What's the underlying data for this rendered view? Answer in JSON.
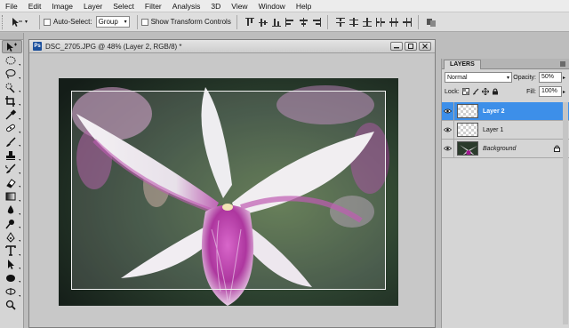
{
  "menu": [
    "File",
    "Edit",
    "Image",
    "Layer",
    "Select",
    "Filter",
    "Analysis",
    "3D",
    "View",
    "Window",
    "Help"
  ],
  "options": {
    "auto_select_label": "Auto-Select:",
    "auto_select_value": "Group",
    "show_transform_label": "Show Transform Controls"
  },
  "tools": [
    "move-tool",
    "marquee-tool",
    "lasso-tool",
    "quick-select-tool",
    "crop-tool",
    "eyedropper-tool",
    "healing-brush-tool",
    "brush-tool",
    "clone-stamp-tool",
    "history-brush-tool",
    "eraser-tool",
    "gradient-tool",
    "blur-tool",
    "dodge-tool",
    "pen-tool",
    "type-tool",
    "path-select-tool",
    "shape-tool",
    "hand-tool",
    "zoom-tool"
  ],
  "document": {
    "badge": "Ps",
    "title": "DSC_2705.JPG @ 48% (Layer 2, RGB/8) *"
  },
  "layers_panel": {
    "tab": "LAYERS",
    "blend_mode": "Normal",
    "opacity_label": "Opacity:",
    "opacity_value": "50%",
    "lock_label": "Lock:",
    "fill_label": "Fill:",
    "fill_value": "100%",
    "layers": [
      {
        "name": "Layer 2",
        "selected": true,
        "italic": false
      },
      {
        "name": "Layer 1",
        "selected": false,
        "italic": false
      },
      {
        "name": "Background",
        "selected": false,
        "italic": true
      }
    ]
  },
  "colors": {
    "selection_blue": "#3d8fe9",
    "ps_badge": "#1b4f9c",
    "orchid_magenta": "#a0168f"
  }
}
